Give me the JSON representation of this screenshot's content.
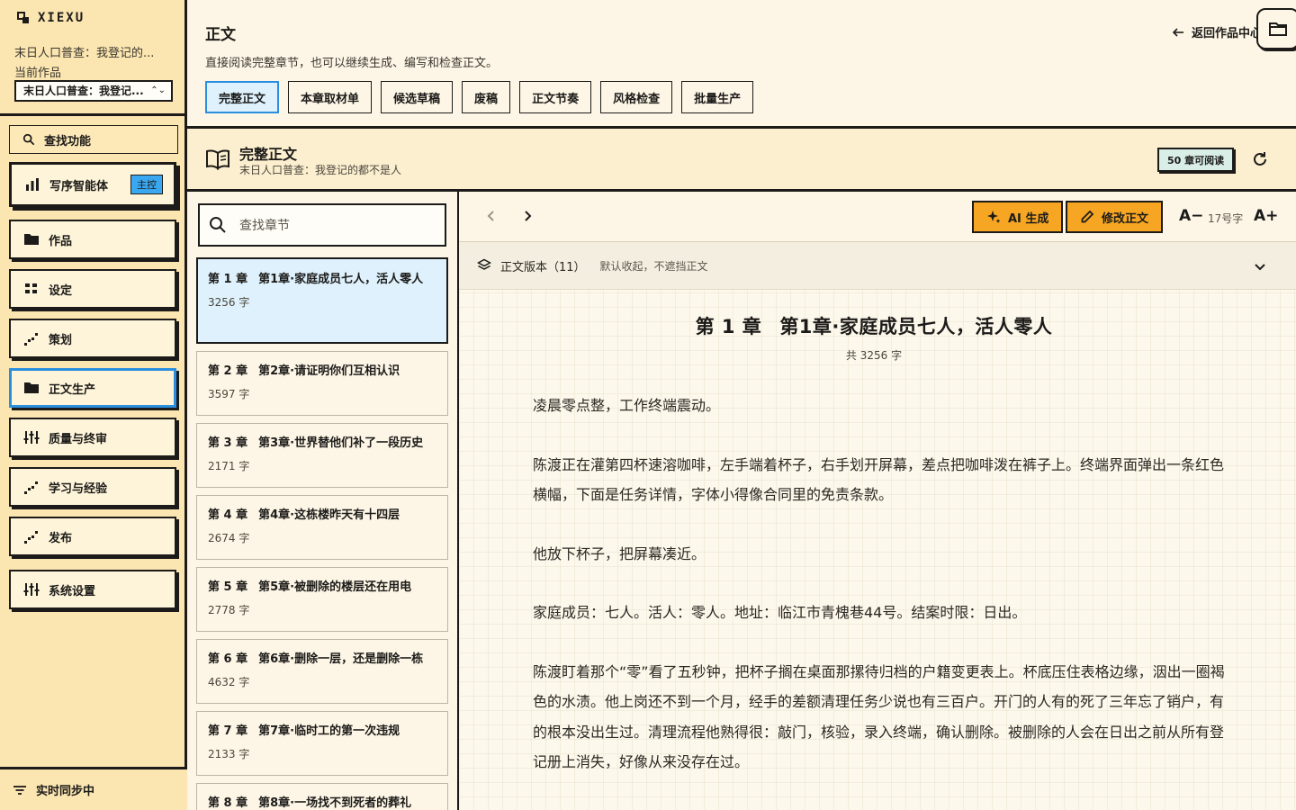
{
  "app": {
    "brand": "XIEXU"
  },
  "project": {
    "name_display": "末日人口普查：我登记的...",
    "current_label": "当前作品",
    "select_value": "末日人口普查：我登记..."
  },
  "sidebar": {
    "search_label": "查找功能",
    "items": [
      {
        "label": "写序智能体",
        "badge": "主控",
        "icon": "bar-chart-icon"
      },
      {
        "label": "作品",
        "icon": "folder-icon"
      },
      {
        "label": "设定",
        "icon": "grid-icon"
      },
      {
        "label": "策划",
        "icon": "trend-icon"
      },
      {
        "label": "正文生产",
        "icon": "folder-icon"
      },
      {
        "label": "质量与终审",
        "icon": "sliders-icon"
      },
      {
        "label": "学习与经验",
        "icon": "trend-icon"
      },
      {
        "label": "发布",
        "icon": "trend-icon"
      },
      {
        "label": "系统设置",
        "icon": "sliders-icon"
      }
    ],
    "footer": "实时同步中"
  },
  "header": {
    "title": "正文",
    "description": "直接阅读完整章节，也可以继续生成、编写和检查正文。",
    "back_label": "返回作品中心",
    "tabs": [
      "完整正文",
      "本章取材单",
      "候选草稿",
      "废稿",
      "正文节奏",
      "风格检查",
      "批量生产"
    ],
    "active_tab": "完整正文"
  },
  "section": {
    "title": "完整正文",
    "subtitle": "末日人口普查：我登记的都不是人",
    "readable_badge": "50 章可阅读"
  },
  "chapter_list": {
    "search_placeholder": "查找章节",
    "chapters": [
      {
        "num": "第 1 章",
        "title": "第1章·家庭成员七人，活人零人",
        "words": "3256 字"
      },
      {
        "num": "第 2 章",
        "title": "第2章·请证明你们互相认识",
        "words": "3597 字"
      },
      {
        "num": "第 3 章",
        "title": "第3章·世界替他们补了一段历史",
        "words": "2171 字"
      },
      {
        "num": "第 4 章",
        "title": "第4章·这栋楼昨天有十四层",
        "words": "2674 字"
      },
      {
        "num": "第 5 章",
        "title": "第5章·被删除的楼层还在用电",
        "words": "2778 字"
      },
      {
        "num": "第 6 章",
        "title": "第6章·删除一层，还是删除一栋",
        "words": "4632 字"
      },
      {
        "num": "第 7 章",
        "title": "第7章·临时工的第一次违规",
        "words": "2133 字"
      },
      {
        "num": "第 8 章",
        "title": "第8章·一场找不到死者的葬礼",
        "words": ""
      }
    ]
  },
  "reader": {
    "ai_button": "AI 生成",
    "edit_button": "修改正文",
    "font_decrease": "A−",
    "font_size": "17号字",
    "font_increase": "A+",
    "version_title": "正文版本（11）",
    "version_note": "默认收起，不遮挡正文",
    "chapter_num": "第 1 章",
    "chapter_title": "第1章·家庭成员七人，活人零人",
    "word_count": "共 3256 字",
    "paragraphs": [
      "凌晨零点整，工作终端震动。",
      "陈渡正在灌第四杯速溶咖啡，左手端着杯子，右手划开屏幕，差点把咖啡泼在裤子上。终端界面弹出一条红色横幅，下面是任务详情，字体小得像合同里的免责条款。",
      "他放下杯子，把屏幕凑近。",
      "家庭成员：七人。活人：零人。地址：临江市青槐巷44号。结案时限：日出。",
      "陈渡盯着那个“零”看了五秒钟，把杯子搁在桌面那摞待归档的户籍变更表上。杯底压住表格边缘，洇出一圈褐色的水渍。他上岗还不到一个月，经手的差额清理任务少说也有三百户。开门的人有的死了三年忘了销户，有的根本没出生过。清理流程他熟得很：敲门，核验，录入终端，确认删除。被删除的人会在日出之前从所有登记册上消失，好像从来没存在过。"
    ]
  }
}
